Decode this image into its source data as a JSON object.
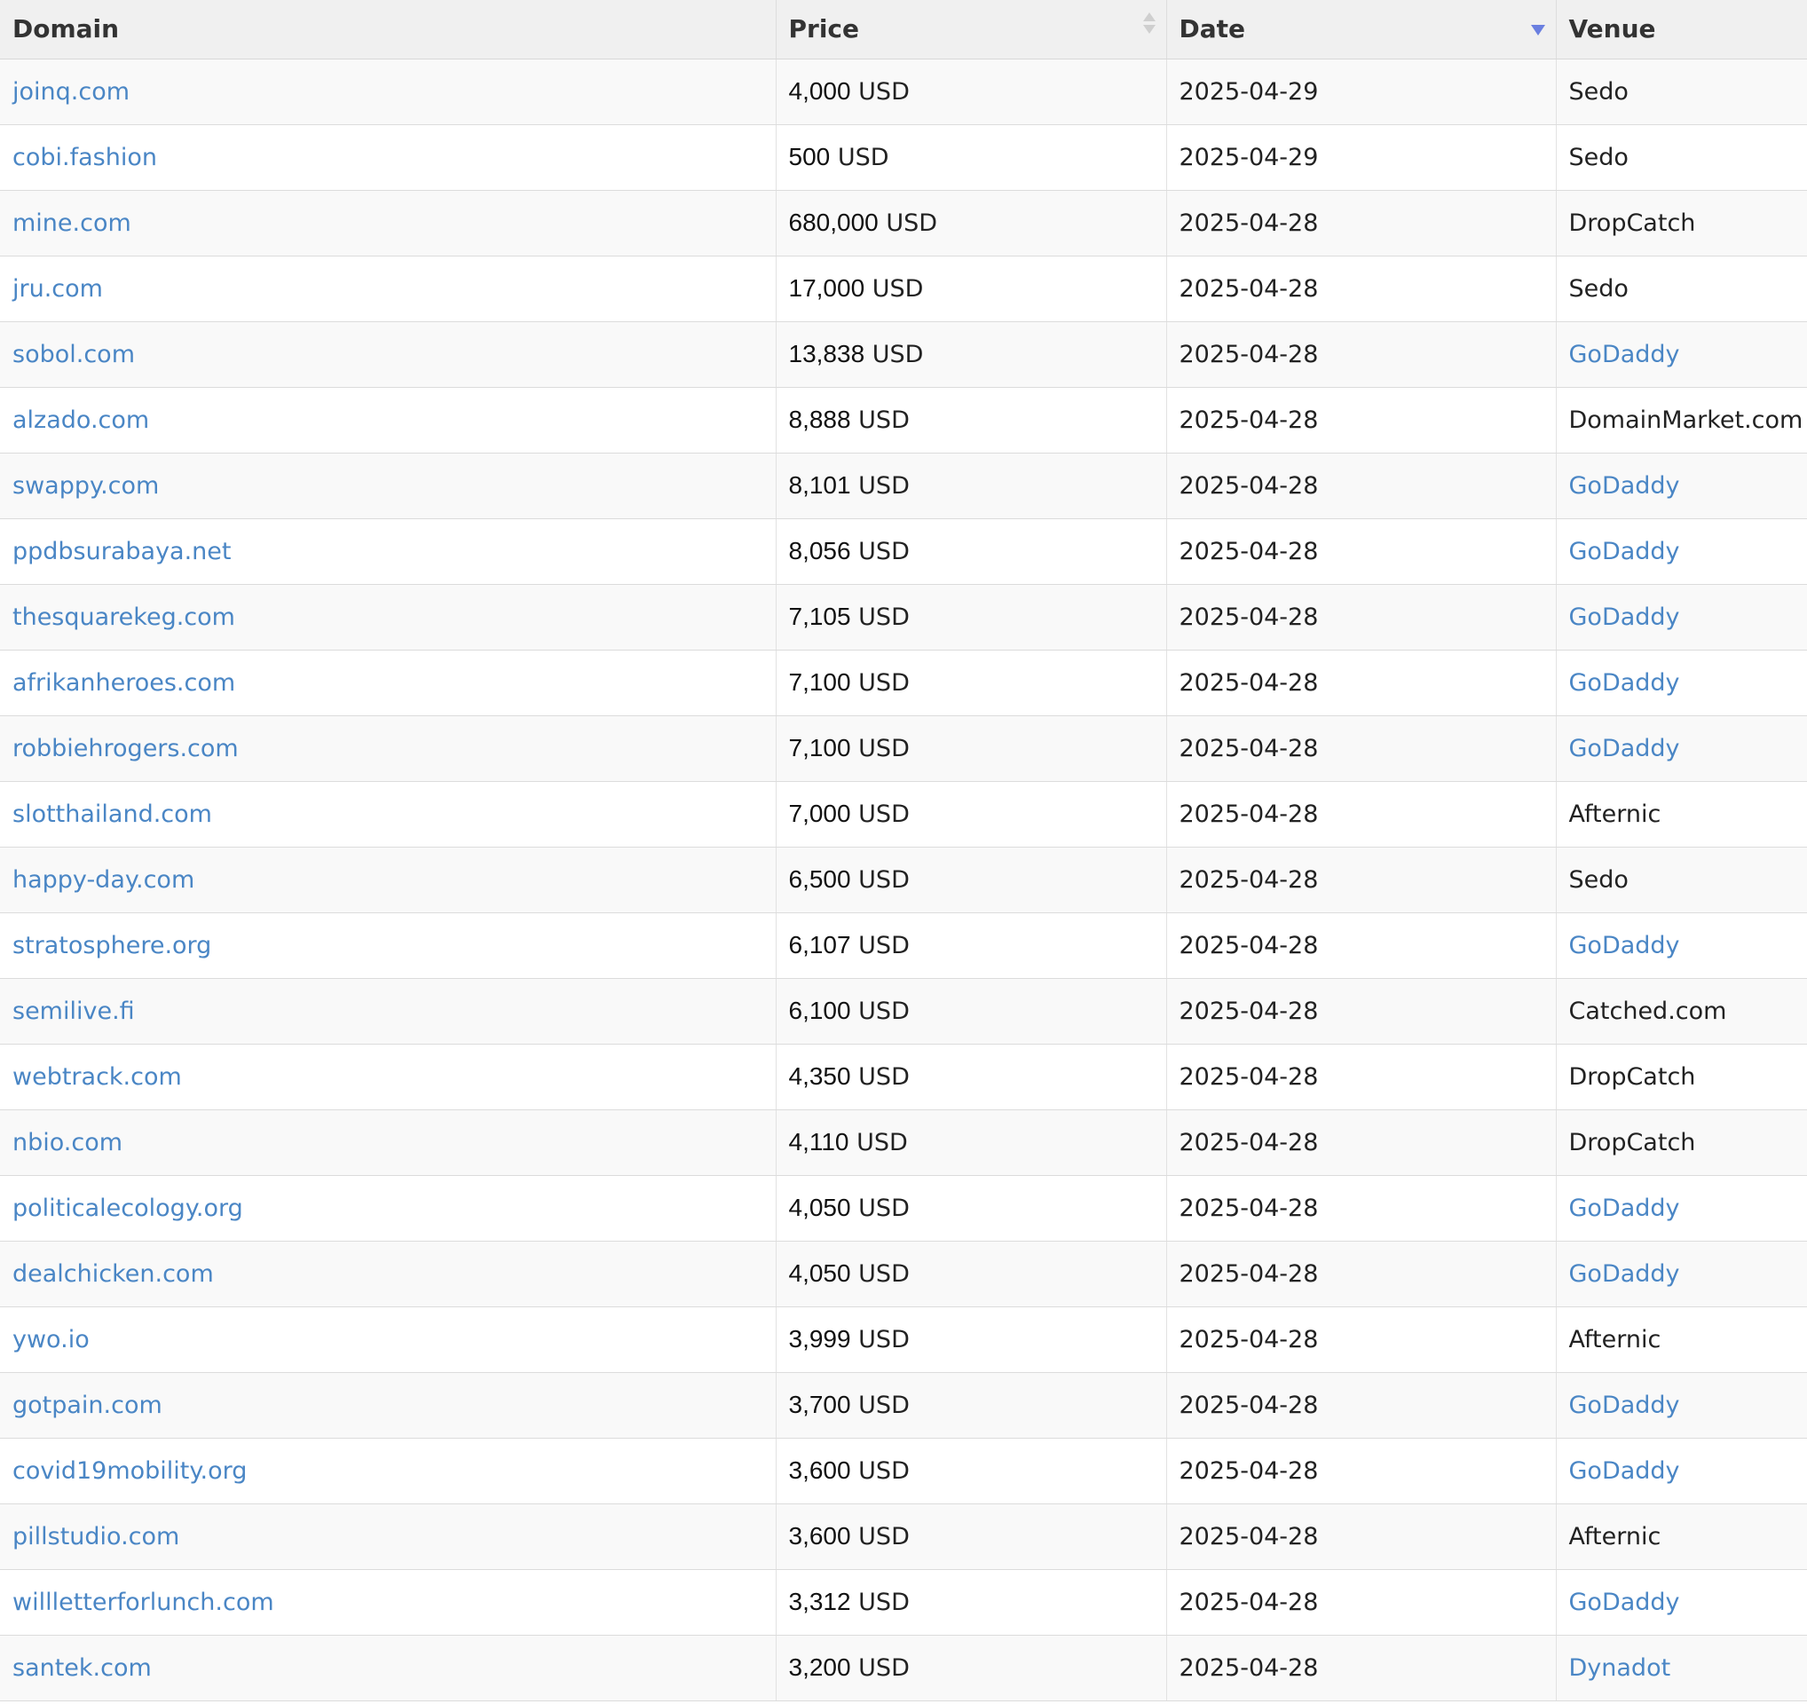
{
  "table": {
    "columns": [
      "Domain",
      "Price",
      "Date",
      "Venue"
    ],
    "sort": {
      "column": "Date",
      "direction": "descending"
    },
    "colors": {
      "link": "#4a86c5",
      "sort_active": "#6a7fe0"
    },
    "rows": [
      {
        "domain": "joinq.com",
        "amount": "4,000",
        "currency": "USD",
        "date": "2025-04-29",
        "venue": "Sedo",
        "venue_link": false
      },
      {
        "domain": "cobi.fashion",
        "amount": "500",
        "currency": "USD",
        "date": "2025-04-29",
        "venue": "Sedo",
        "venue_link": false
      },
      {
        "domain": "mine.com",
        "amount": "680,000",
        "currency": "USD",
        "date": "2025-04-28",
        "venue": "DropCatch",
        "venue_link": false
      },
      {
        "domain": "jru.com",
        "amount": "17,000",
        "currency": "USD",
        "date": "2025-04-28",
        "venue": "Sedo",
        "venue_link": false
      },
      {
        "domain": "sobol.com",
        "amount": "13,838",
        "currency": "USD",
        "date": "2025-04-28",
        "venue": "GoDaddy",
        "venue_link": true
      },
      {
        "domain": "alzado.com",
        "amount": "8,888",
        "currency": "USD",
        "date": "2025-04-28",
        "venue": "DomainMarket.com",
        "venue_link": false
      },
      {
        "domain": "swappy.com",
        "amount": "8,101",
        "currency": "USD",
        "date": "2025-04-28",
        "venue": "GoDaddy",
        "venue_link": true
      },
      {
        "domain": "ppdbsurabaya.net",
        "amount": "8,056",
        "currency": "USD",
        "date": "2025-04-28",
        "venue": "GoDaddy",
        "venue_link": true
      },
      {
        "domain": "thesquarekeg.com",
        "amount": "7,105",
        "currency": "USD",
        "date": "2025-04-28",
        "venue": "GoDaddy",
        "venue_link": true
      },
      {
        "domain": "afrikanheroes.com",
        "amount": "7,100",
        "currency": "USD",
        "date": "2025-04-28",
        "venue": "GoDaddy",
        "venue_link": true
      },
      {
        "domain": "robbiehrogers.com",
        "amount": "7,100",
        "currency": "USD",
        "date": "2025-04-28",
        "venue": "GoDaddy",
        "venue_link": true
      },
      {
        "domain": "slotthailand.com",
        "amount": "7,000",
        "currency": "USD",
        "date": "2025-04-28",
        "venue": "Afternic",
        "venue_link": false
      },
      {
        "domain": "happy-day.com",
        "amount": "6,500",
        "currency": "USD",
        "date": "2025-04-28",
        "venue": "Sedo",
        "venue_link": false
      },
      {
        "domain": "stratosphere.org",
        "amount": "6,107",
        "currency": "USD",
        "date": "2025-04-28",
        "venue": "GoDaddy",
        "venue_link": true
      },
      {
        "domain": "semilive.fi",
        "amount": "6,100",
        "currency": "USD",
        "date": "2025-04-28",
        "venue": "Catched.com",
        "venue_link": false
      },
      {
        "domain": "webtrack.com",
        "amount": "4,350",
        "currency": "USD",
        "date": "2025-04-28",
        "venue": "DropCatch",
        "venue_link": false
      },
      {
        "domain": "nbio.com",
        "amount": "4,110",
        "currency": "USD",
        "date": "2025-04-28",
        "venue": "DropCatch",
        "venue_link": false
      },
      {
        "domain": "politicalecology.org",
        "amount": "4,050",
        "currency": "USD",
        "date": "2025-04-28",
        "venue": "GoDaddy",
        "venue_link": true
      },
      {
        "domain": "dealchicken.com",
        "amount": "4,050",
        "currency": "USD",
        "date": "2025-04-28",
        "venue": "GoDaddy",
        "venue_link": true
      },
      {
        "domain": "ywo.io",
        "amount": "3,999",
        "currency": "USD",
        "date": "2025-04-28",
        "venue": "Afternic",
        "venue_link": false
      },
      {
        "domain": "gotpain.com",
        "amount": "3,700",
        "currency": "USD",
        "date": "2025-04-28",
        "venue": "GoDaddy",
        "venue_link": true
      },
      {
        "domain": "covid19mobility.org",
        "amount": "3,600",
        "currency": "USD",
        "date": "2025-04-28",
        "venue": "GoDaddy",
        "venue_link": true
      },
      {
        "domain": "pillstudio.com",
        "amount": "3,600",
        "currency": "USD",
        "date": "2025-04-28",
        "venue": "Afternic",
        "venue_link": false
      },
      {
        "domain": "willletterforlunch.com",
        "amount": "3,312",
        "currency": "USD",
        "date": "2025-04-28",
        "venue": "GoDaddy",
        "venue_link": true
      },
      {
        "domain": "santek.com",
        "amount": "3,200",
        "currency": "USD",
        "date": "2025-04-28",
        "venue": "Dynadot",
        "venue_link": true
      }
    ]
  }
}
